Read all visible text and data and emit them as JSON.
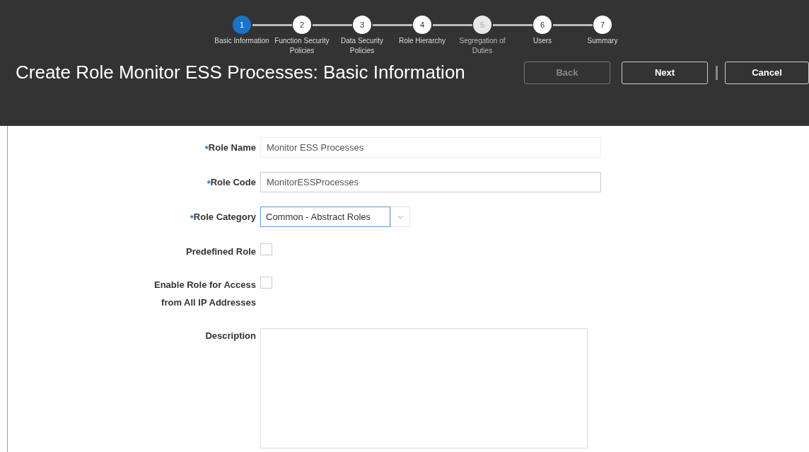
{
  "train": {
    "steps": [
      {
        "number": "1",
        "label": "Basic Information",
        "selected": true,
        "disabled": false
      },
      {
        "number": "2",
        "label": "Function Security Policies",
        "selected": false,
        "disabled": false
      },
      {
        "number": "3",
        "label": "Data Security Policies",
        "selected": false,
        "disabled": false
      },
      {
        "number": "4",
        "label": "Role Hierarchy",
        "selected": false,
        "disabled": false
      },
      {
        "number": "5",
        "label": "Segregation of Duties",
        "selected": false,
        "disabled": true
      },
      {
        "number": "6",
        "label": "Users",
        "selected": false,
        "disabled": false
      },
      {
        "number": "7",
        "label": "Summary",
        "selected": false,
        "disabled": false
      }
    ]
  },
  "page_title": "Create Role Monitor ESS Processes: Basic Information",
  "buttons": [
    {
      "label": "Back",
      "disabled": true
    },
    {
      "label": "Next",
      "disabled": false
    },
    {
      "label": "Cancel",
      "disabled": false
    }
  ],
  "form": {
    "fields": [
      {
        "kind": "text",
        "required_mark": "*",
        "label": "Role Name",
        "value": "Monitor ESS Processes",
        "readonly": true
      },
      {
        "kind": "text",
        "required_mark": "*",
        "label": "Role Code",
        "value": "MonitorESSProcesses",
        "readonly": false
      },
      {
        "kind": "select",
        "required_mark": "*",
        "label": "Role Category",
        "value": "Common - Abstract Roles"
      },
      {
        "kind": "checkbox",
        "label": "Predefined Role",
        "checked": false
      },
      {
        "kind": "checkbox",
        "label": "Enable Role for Access from All IP Addresses",
        "checked": false
      },
      {
        "kind": "textarea",
        "label": "Description"
      }
    ]
  }
}
